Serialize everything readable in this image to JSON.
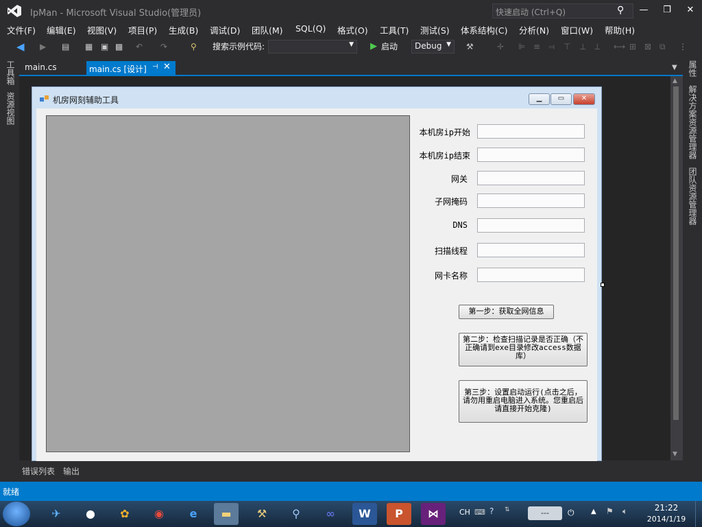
{
  "titlebar": {
    "title": "IpMan - Microsoft Visual Studio(管理员)",
    "quicklaunch_placeholder": "快速启动 (Ctrl+Q)"
  },
  "menu": [
    "文件(F)",
    "编辑(E)",
    "视图(V)",
    "项目(P)",
    "生成(B)",
    "调试(D)",
    "团队(M)",
    "SQL(Q)",
    "格式(O)",
    "工具(T)",
    "测试(S)",
    "体系结构(C)",
    "分析(N)",
    "窗口(W)",
    "帮助(H)"
  ],
  "toolbar": {
    "search_example_label": "搜索示例代码:",
    "start_label": "启动",
    "config": "Debug"
  },
  "tabs": {
    "tab1": "main.cs",
    "tab2": "main.cs [设计]"
  },
  "left_rail": [
    "工具箱",
    "资源视图"
  ],
  "right_rail": [
    "属性",
    "解决方案资源管理器",
    "团队资源管理器"
  ],
  "form": {
    "title": "机房网刻辅助工具",
    "labels": [
      "本机房ip开始",
      "本机房ip结束",
      "网关",
      "子网掩码",
      "DNS",
      "扫描线程",
      "网卡名称"
    ],
    "btn_step1": "第一步：获取全网信息",
    "btn_step2": "第二步：检查扫描记录是否正确（不正确请到exe目录修改access数据库）",
    "btn_step3": "第三步：设置启动运行(点击之后，请勿用重启电脑进入系统。您重启后请直接开始克隆)"
  },
  "bottom_tabs": [
    "错误列表",
    "输出"
  ],
  "status": "就绪",
  "taskbar": {
    "lang": "CH",
    "time": "21:22",
    "date": "2014/1/19"
  },
  "colors": {
    "accent": "#007acc",
    "vs_purple": "#68217a"
  }
}
